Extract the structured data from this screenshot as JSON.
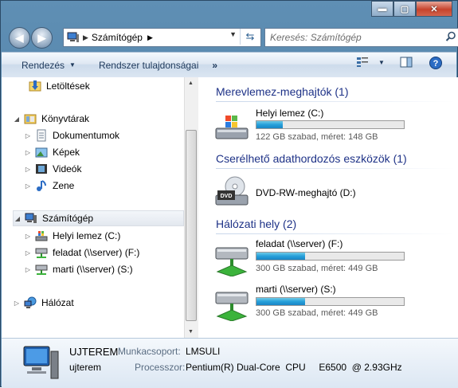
{
  "address": {
    "location": "Számítógép"
  },
  "search": {
    "placeholder": "Keresés: Számítógép"
  },
  "toolbar": {
    "organize": "Rendezés",
    "system_props": "Rendszer tulajdonságai",
    "more": "»"
  },
  "nav": {
    "downloads": "Letöltések",
    "libraries": "Könyvtárak",
    "documents": "Dokumentumok",
    "pictures": "Képek",
    "videos": "Videók",
    "music": "Zene",
    "computer": "Számítógép",
    "local_disk": "Helyi lemez (C:)",
    "feladat": "feladat (\\\\server) (F:)",
    "marti": "marti (\\\\server) (S:)",
    "network": "Hálózat"
  },
  "groups": {
    "hdd": "Merevlemez-meghajtók (1)",
    "removable": "Cserélhető adathordozós eszközök (1)",
    "network": "Hálózati hely (2)"
  },
  "drives": [
    {
      "name": "Helyi lemez (C:)",
      "info": "122 GB szabad, méret: 148 GB",
      "used_fraction": 0.18
    },
    {
      "name": "DVD-RW-meghajtó (D:)"
    },
    {
      "name": "feladat (\\\\server) (F:)",
      "info": "300 GB szabad, méret: 449 GB",
      "used_fraction": 0.33
    },
    {
      "name": "marti (\\\\server) (S:)",
      "info": "300 GB szabad, méret: 449 GB",
      "used_fraction": 0.33
    }
  ],
  "details": {
    "computer_name": "UJTEREM",
    "workgroup_label": "Munkacsoport:",
    "workgroup": "LMSULI",
    "user": "ujterem",
    "processor_label": "Processzor:",
    "processor": "Pentium(R) Dual-Core  CPU     E6500  @ 2.93GHz"
  },
  "colors": {
    "accent": "#1e3287",
    "bar_fill": "#26a0da"
  },
  "icons": {
    "back": "back-arrow-icon",
    "forward": "forward-arrow-icon",
    "refresh": "refresh-icon",
    "search": "search-icon",
    "views": "views-icon",
    "preview": "preview-pane-icon",
    "help": "help-icon"
  }
}
